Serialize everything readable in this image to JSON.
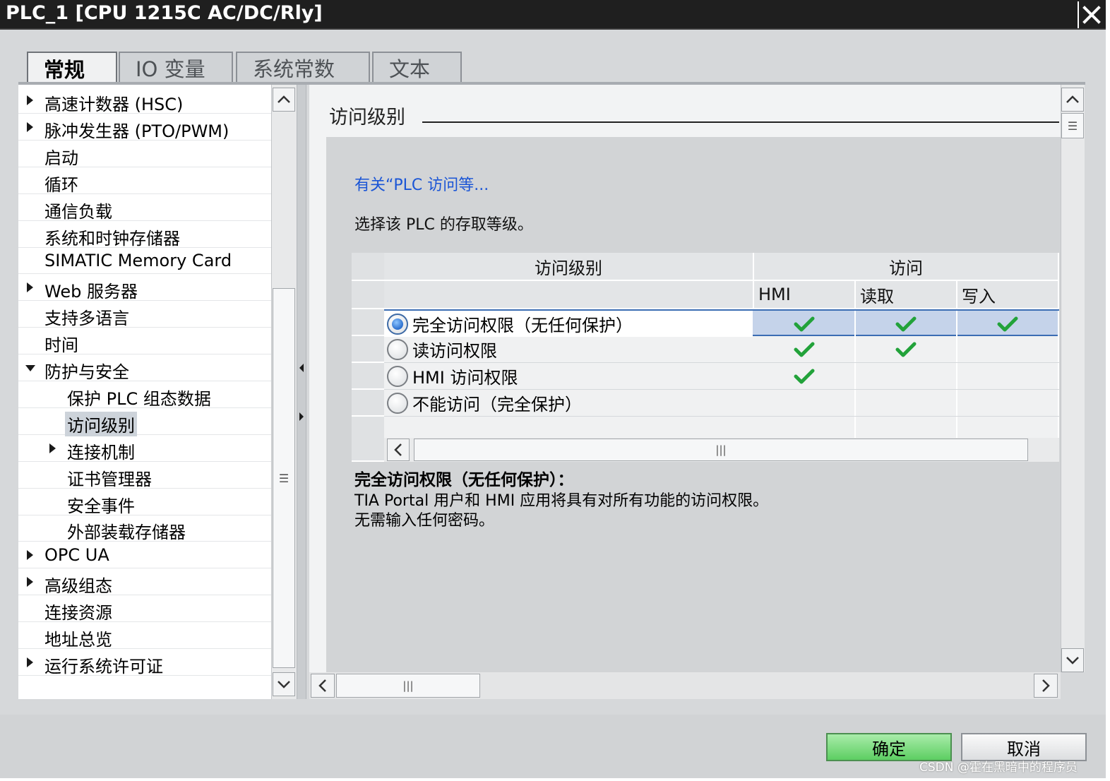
{
  "window": {
    "title": "PLC_1 [CPU 1215C AC/DC/Rly]",
    "close_glyph": "✕"
  },
  "tabs": [
    {
      "label": "常规",
      "active": true
    },
    {
      "label": "IO 变量",
      "active": false
    },
    {
      "label": "系统常数",
      "active": false
    },
    {
      "label": "文本",
      "active": false
    }
  ],
  "nav": {
    "items": [
      {
        "label": "高速计数器 (HSC)",
        "expander": "collapsed",
        "level": 0
      },
      {
        "label": "脉冲发生器 (PTO/PWM)",
        "expander": "collapsed",
        "level": 0
      },
      {
        "label": "启动",
        "expander": "none",
        "level": 0
      },
      {
        "label": "循环",
        "expander": "none",
        "level": 0
      },
      {
        "label": "通信负载",
        "expander": "none",
        "level": 0
      },
      {
        "label": "系统和时钟存储器",
        "expander": "none",
        "level": 0
      },
      {
        "label": "SIMATIC Memory Card",
        "expander": "none",
        "level": 0
      },
      {
        "label": "Web 服务器",
        "expander": "collapsed",
        "level": 0
      },
      {
        "label": "支持多语言",
        "expander": "none",
        "level": 0
      },
      {
        "label": "时间",
        "expander": "none",
        "level": 0
      },
      {
        "label": "防护与安全",
        "expander": "expanded",
        "level": 0
      },
      {
        "label": "保护 PLC 组态数据",
        "expander": "none",
        "level": 1
      },
      {
        "label": "访问级别",
        "expander": "none",
        "level": 1,
        "selected": true
      },
      {
        "label": "连接机制",
        "expander": "collapsed",
        "level": 1
      },
      {
        "label": "证书管理器",
        "expander": "none",
        "level": 1
      },
      {
        "label": "安全事件",
        "expander": "none",
        "level": 1
      },
      {
        "label": "外部装载存储器",
        "expander": "none",
        "level": 1
      },
      {
        "label": "OPC UA",
        "expander": "collapsed",
        "level": 0
      },
      {
        "label": "高级组态",
        "expander": "collapsed",
        "level": 0
      },
      {
        "label": "连接资源",
        "expander": "none",
        "level": 0
      },
      {
        "label": "地址总览",
        "expander": "none",
        "level": 0
      },
      {
        "label": "运行系统许可证",
        "expander": "collapsed",
        "level": 0
      }
    ]
  },
  "content": {
    "section_title": "访问级别",
    "help_link": "有关“PLC 访问等...",
    "instruction": "选择该 PLC 的存取等级。",
    "table": {
      "header_level": "访问级别",
      "header_access": "访问",
      "sub_headers": [
        "HMI",
        "读取",
        "写入"
      ],
      "rows": [
        {
          "label": "完全访问权限（无任何保护）",
          "selected": true,
          "hmi": true,
          "read": true,
          "write": true
        },
        {
          "label": "读访问权限",
          "selected": false,
          "hmi": true,
          "read": true,
          "write": false
        },
        {
          "label": "HMI 访问权限",
          "selected": false,
          "hmi": true,
          "read": false,
          "write": false
        },
        {
          "label": "不能访问（完全保护）",
          "selected": false,
          "hmi": false,
          "read": false,
          "write": false
        }
      ]
    },
    "description": {
      "title": "完全访问权限（无任何保护）：",
      "line1": "TIA Portal 用户和 HMI 应用将具有对所有功能的访问权限。",
      "line2": "无需输入任何密码。"
    },
    "scroll_grip": "|||"
  },
  "buttons": {
    "ok": "确定",
    "cancel": "取消"
  },
  "watermark": "CSDN @霍在黑暗中的程序员",
  "colors": {
    "titlebar": "#1f1f1f",
    "link": "#1a55d6",
    "check": "#22a23a",
    "selected_row": "#c5d3ea",
    "ok_button": "#6fd474"
  },
  "icons": {
    "check": "check-icon",
    "scroll_up": "chevron-up-icon",
    "scroll_down": "chevron-down-icon",
    "scroll_left": "chevron-left-icon",
    "scroll_right": "chevron-right-icon"
  }
}
